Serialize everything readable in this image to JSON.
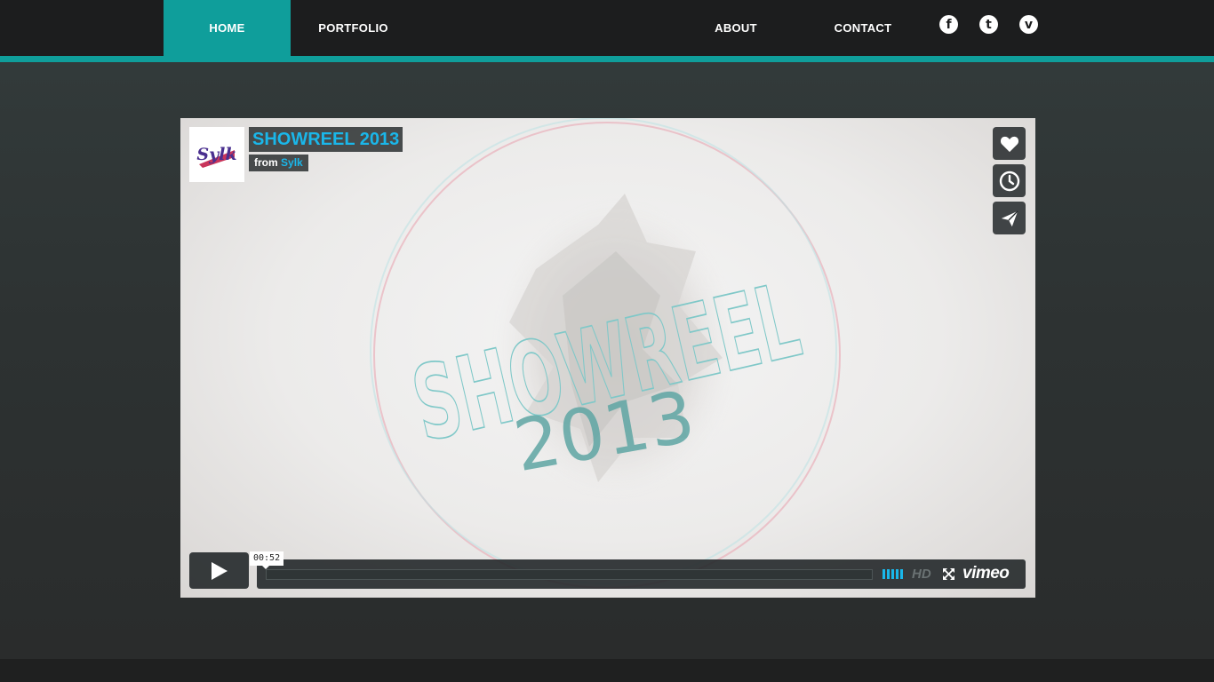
{
  "nav": {
    "home": "HOME",
    "portfolio": "PORTFOLIO",
    "about": "ABOUT",
    "contact": "CONTACT"
  },
  "social": {
    "facebook": "f",
    "twitter": "t",
    "vimeo": "v"
  },
  "video": {
    "title": "SHOWREEL 2013",
    "from_label": "from",
    "author": "Sylk",
    "logo_text": "Sylk",
    "frame_word_1": "SHOWREEL",
    "frame_word_2": "2013",
    "time": "00:52",
    "hd": "HD",
    "brand": "vimeo",
    "volume_bars": 5
  },
  "colors": {
    "accent": "#0f9e9b",
    "vimeo_blue": "#1ab7ea",
    "nav_bg": "#1c1d1e"
  },
  "icons": [
    "facebook-icon",
    "twitter-icon",
    "vimeo-icon",
    "heart-icon",
    "clock-icon",
    "send-icon",
    "play-icon",
    "fullscreen-icon"
  ]
}
